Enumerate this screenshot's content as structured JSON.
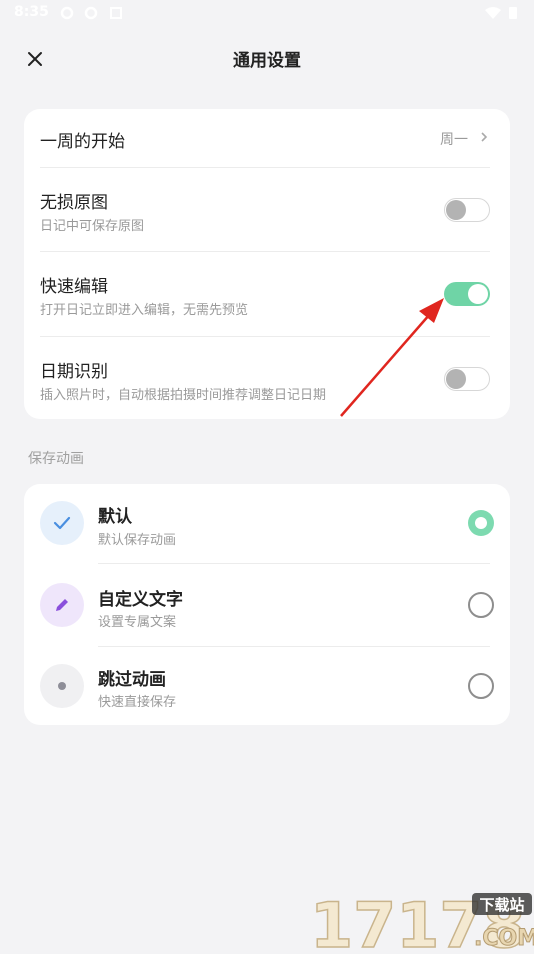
{
  "status_bar": {
    "time": "8:35"
  },
  "header": {
    "title": "通用设置",
    "close_icon": "close-icon"
  },
  "settings": {
    "week_start": {
      "title": "一周的开始",
      "value": "周一"
    },
    "lossless": {
      "title": "无损原图",
      "subtitle": "日记中可保存原图",
      "enabled": false
    },
    "quick_edit": {
      "title": "快速编辑",
      "subtitle": "打开日记立即进入编辑，无需先预览",
      "enabled": true
    },
    "date_detect": {
      "title": "日期识别",
      "subtitle": "插入照片时，自动根据拍摄时间推荐调整日记日期",
      "enabled": false
    }
  },
  "save_animation": {
    "section_label": "保存动画",
    "options": [
      {
        "title": "默认",
        "subtitle": "默认保存动画",
        "icon": "check-icon",
        "selected": true
      },
      {
        "title": "自定义文字",
        "subtitle": "设置专属文案",
        "icon": "pencil-icon",
        "selected": false
      },
      {
        "title": "跳过动画",
        "subtitle": "快速直接保存",
        "icon": "dot-icon",
        "selected": false
      }
    ]
  },
  "watermark": {
    "brand": "17178",
    "tag": "下载站",
    "suffix": ".COM"
  },
  "colors": {
    "accent": "#6fd4a6",
    "annotation_arrow": "#e0261f"
  }
}
